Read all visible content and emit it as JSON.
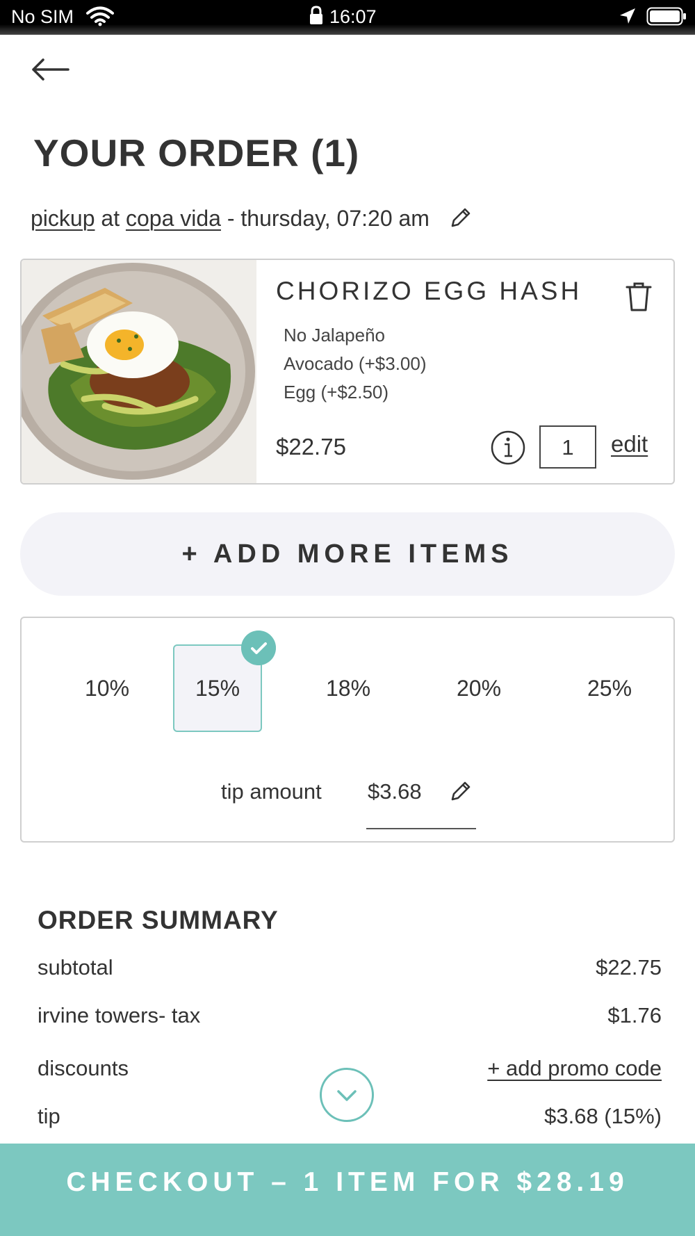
{
  "status_bar": {
    "carrier": "No SIM",
    "time": "16:07"
  },
  "header": {
    "title": "YOUR ORDER (1)"
  },
  "pickup": {
    "mode": "pickup",
    "at": "at",
    "location": "copa vida",
    "datetime": "- thursday, 07:20 am"
  },
  "item": {
    "name": "CHORIZO EGG HASH",
    "modifiers": [
      "No Jalapeño",
      "Avocado (+$3.00)",
      "Egg (+$2.50)"
    ],
    "price": "$22.75",
    "quantity": "1",
    "edit_label": "edit"
  },
  "add_more_label": "+ ADD MORE ITEMS",
  "tip": {
    "options": [
      "10%",
      "15%",
      "18%",
      "20%",
      "25%"
    ],
    "selected": "15%",
    "amount_label": "tip amount",
    "amount_value": "$3.68"
  },
  "summary": {
    "title": "ORDER SUMMARY",
    "subtotal_label": "subtotal",
    "subtotal_value": "$22.75",
    "tax_label": "irvine towers- tax",
    "tax_value": "$1.76",
    "discounts_label": "discounts",
    "promo_label": "+ add promo code",
    "tip_label": "tip",
    "tip_value": "$3.68 (15%)"
  },
  "checkout_label": "CHECKOUT – 1 ITEM FOR $28.19",
  "colors": {
    "accent": "#7cc8c0",
    "text": "#333333",
    "surface": "#f3f3f8"
  }
}
